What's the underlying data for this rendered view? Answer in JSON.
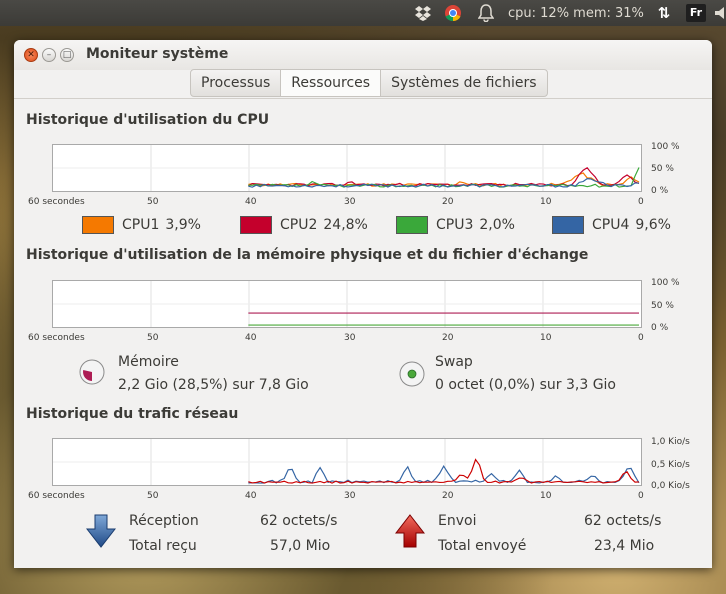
{
  "top_panel": {
    "sysload_text": "cpu: 12% mem: 31%",
    "keyboard_layout": "Fr",
    "icons": [
      "dropbox-icon",
      "chrome-icon",
      "notification-bell-icon",
      "network-arrows-icon",
      "volume-icon"
    ]
  },
  "window": {
    "title": "Moniteur système",
    "tabs": [
      {
        "label": "Processus",
        "active": false
      },
      {
        "label": "Ressources",
        "active": true
      },
      {
        "label": "Systèmes de fichiers",
        "active": false
      }
    ]
  },
  "cpu": {
    "title": "Historique d'utilisation du CPU",
    "x_ticks": [
      "60 secondes",
      "50",
      "40",
      "30",
      "20",
      "10",
      "0"
    ],
    "y_ticks": [
      "100 %",
      "50 %",
      "0 %"
    ],
    "legend": [
      {
        "label": "CPU1",
        "value": "3,9%",
        "color": "#f57900"
      },
      {
        "label": "CPU2",
        "value": "24,8%",
        "color": "#c4002c"
      },
      {
        "label": "CPU3",
        "value": "2,0%",
        "color": "#3aa83a"
      },
      {
        "label": "CPU4",
        "value": "9,6%",
        "color": "#3465a4"
      }
    ]
  },
  "memory": {
    "title": "Historique d'utilisation de la mémoire physique et du fichier d'échange",
    "x_ticks": [
      "60 secondes",
      "50",
      "40",
      "30",
      "20",
      "10",
      "0"
    ],
    "y_ticks": [
      "100 %",
      "50 %",
      "0 %"
    ],
    "ram": {
      "label": "Mémoire",
      "detail": "2,2 Gio (28,5%) sur 7,8 Gio",
      "fraction": 0.285,
      "color": "#ad1d54"
    },
    "swap": {
      "label": "Swap",
      "detail": "0 octet (0,0%) sur 3,3 Gio",
      "fraction": 0.0,
      "color": "#4aa83a"
    }
  },
  "network": {
    "title": "Historique du trafic réseau",
    "x_ticks": [
      "60 secondes",
      "50",
      "40",
      "30",
      "20",
      "10",
      "0"
    ],
    "y_ticks": [
      "1,0 Kio/s",
      "0,5 Kio/s",
      "0,0 Kio/s"
    ],
    "reception": {
      "label": "Réception",
      "rate": "62 octets/s",
      "total_label": "Total reçu",
      "total": "57,0 Mio",
      "color": "#3465a4"
    },
    "sending": {
      "label": "Envoi",
      "rate": "62 octets/s",
      "total_label": "Total envoyé",
      "total": "23,4 Mio",
      "color": "#cc0000"
    }
  }
}
